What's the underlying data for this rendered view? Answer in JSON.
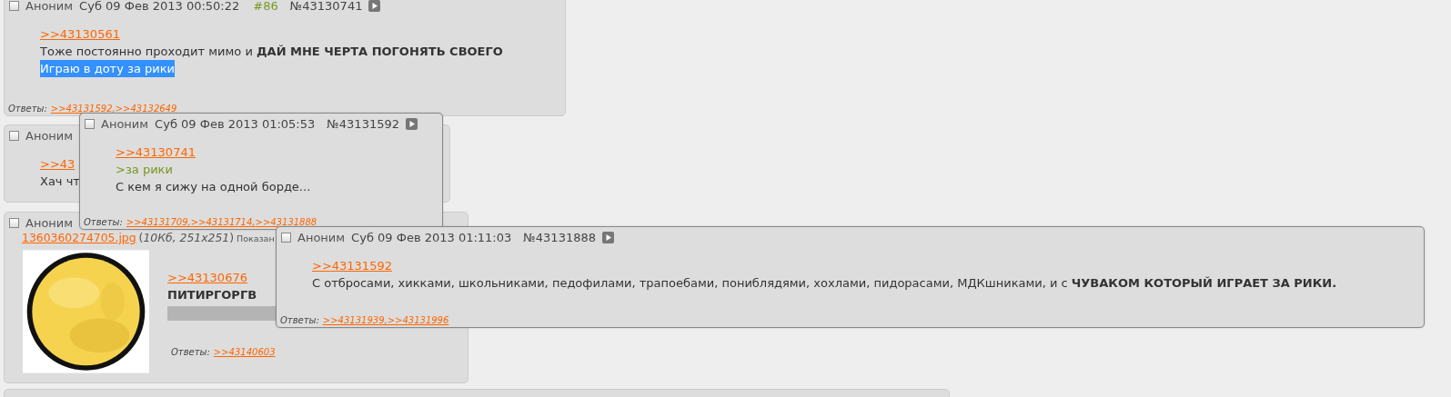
{
  "posts": [
    {
      "checked": false,
      "name": "Аноним",
      "date": "Суб 09 Фев 2013 00:50:22",
      "index": "#86",
      "number": "№43130741",
      "body": [
        {
          "kind": "link",
          "text": ">>43130561"
        },
        {
          "kind": "text",
          "text": "Тоже постоянно проходит мимо и **ДАЙ МНЕ ЧЕРТА ПОГОНЯТЬ СВОЕГО**"
        },
        {
          "kind": "selection",
          "text": "Играю в доту за рики"
        }
      ],
      "replies_label": "Ответы:",
      "replies": [
        ">>43131592,",
        ">>43132649"
      ]
    },
    {
      "checked": false,
      "name": "Аноним",
      "body": [
        {
          "kind": "link",
          "text": ">>43"
        },
        {
          "kind": "text",
          "text": "Хач чт"
        }
      ]
    },
    {
      "checked": false,
      "name": "Аноним",
      "file": {
        "name": "1360360274705.jpg",
        "info": "(*10Кб, 251x251*)",
        "note": "Показан",
        "kind": "picture"
      },
      "body": [
        {
          "kind": "link",
          "text": ">>43130676"
        },
        {
          "kind": "bold",
          "text": "ПИТИРГОРГВ"
        },
        {
          "kind": "bar"
        }
      ],
      "replies_label": "Ответы:",
      "replies": [
        ">>43140603"
      ]
    }
  ],
  "popups": [
    {
      "checked": false,
      "name": "Аноним",
      "date": "Суб 09 Фев 2013 01:05:53",
      "number": "№43131592",
      "body": [
        {
          "kind": "link",
          "text": ">>43130741"
        },
        {
          "kind": "greentext",
          "text": ">за рики"
        },
        {
          "kind": "text",
          "text": "С кем я сижу на одной борде..."
        }
      ],
      "replies_label": "Ответы:",
      "replies": [
        ">>43131709,",
        ">>43131714,",
        ">>43131888"
      ]
    },
    {
      "checked": false,
      "name": "Аноним",
      "date": "Суб 09 Фев 2013 01:11:03",
      "number": "№43131888",
      "body": [
        {
          "kind": "link",
          "text": ">>43131592"
        },
        {
          "kind": "text",
          "text": "С отбросами, хикками, школьниками, педофилами, трапоебами, пониблядями, хохлами, пидорасами, МДКшниками, и с **ЧУВАКОМ КОТОРЫЙ ИГРАЕТ ЗА РИКИ.**"
        }
      ],
      "replies_label": "Ответы:",
      "replies": [
        ">>43131939,",
        ">>43131996"
      ]
    }
  ]
}
